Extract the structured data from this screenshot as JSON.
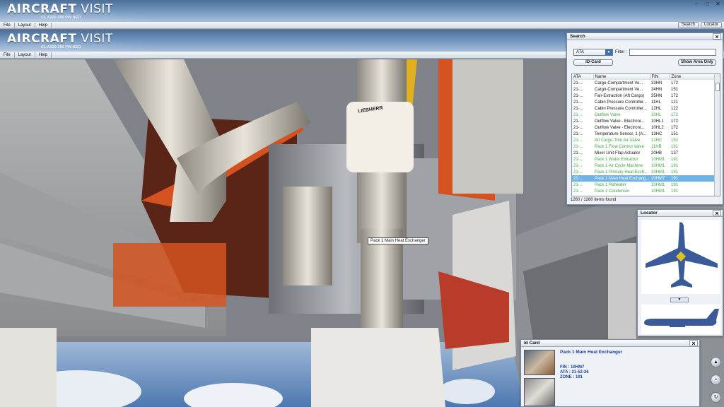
{
  "app": {
    "title_bold": "AIRCRAFT",
    "title_light": " VISIT",
    "subtitle": "CL A320-200 PW NEO",
    "menu": [
      "File",
      "Layout",
      "Help"
    ],
    "buttons": {
      "search": "Search",
      "locator": "Locator"
    }
  },
  "scene": {
    "tooltip": "Pack 1 Main Heat Exchanger",
    "sticker_brand": "LIEBHERR"
  },
  "search": {
    "title": "Search",
    "ata_select": "ATA",
    "filter_label": "Filter :",
    "filter_value": "",
    "id_card_button": "ID-Card",
    "show_area_button": "Show Area Only",
    "columns": [
      "ATA",
      "Name",
      "FIN",
      "Zone"
    ],
    "rows": [
      {
        "ata": "21-...",
        "name": "Cargo-Compartment Ve...",
        "fin": "33HN",
        "zone": "172",
        "style": "normal"
      },
      {
        "ata": "21-...",
        "name": "Cargo-Compartment Ve...",
        "fin": "34HN",
        "zone": "151",
        "style": "normal"
      },
      {
        "ata": "21-...",
        "name": "Fan-Extraction (Aft Cargo)",
        "fin": "35HN",
        "zone": "172",
        "style": "normal"
      },
      {
        "ata": "21-...",
        "name": "Cabin Pressure Controller...",
        "fin": "11HL",
        "zone": "121",
        "style": "normal"
      },
      {
        "ata": "21-...",
        "name": "Cabin Pressure Controller...",
        "fin": "12HL",
        "zone": "122",
        "style": "normal"
      },
      {
        "ata": "21-...",
        "name": "Outflow Valve",
        "fin": "10HL",
        "zone": "172",
        "style": "green"
      },
      {
        "ata": "21-...",
        "name": "Outflow Valve - Electroni...",
        "fin": "10HL1",
        "zone": "172",
        "style": "normal"
      },
      {
        "ata": "21-...",
        "name": "Outflow Valve - Electroni...",
        "fin": "10HL2",
        "zone": "172",
        "style": "normal"
      },
      {
        "ata": "21-...",
        "name": "Temperature Sensor, 1 (A...",
        "fin": "13HC",
        "zone": "151",
        "style": "normal"
      },
      {
        "ata": "21-...",
        "name": "Aft Cargo-Trim Air-Valve",
        "fin": "12HC",
        "zone": "151",
        "style": "green"
      },
      {
        "ata": "21-...",
        "name": "Pack 1 Flow Control Valve",
        "fin": "11HB",
        "zone": "191",
        "style": "green"
      },
      {
        "ata": "21-...",
        "name": "Mixer Unit-Flap Actuator",
        "fin": "20HB",
        "zone": "137",
        "style": "normal"
      },
      {
        "ata": "21-...",
        "name": "Pack 1 Water Extractor",
        "fin": "10HM1",
        "zone": "191",
        "style": "green"
      },
      {
        "ata": "21-...",
        "name": "Pack 1 Air Cycle Machine",
        "fin": "10HM1",
        "zone": "191",
        "style": "green"
      },
      {
        "ata": "21-...",
        "name": "Pack 1 Primary Heat Exch...",
        "fin": "10HM1",
        "zone": "191",
        "style": "green"
      },
      {
        "ata": "21-...",
        "name": "Pack 1 Main Heat Exchang...",
        "fin": "10HM7",
        "zone": "191",
        "style": "sel"
      },
      {
        "ata": "21-...",
        "name": "Pack 1 Reheater",
        "fin": "10HM1",
        "zone": "191",
        "style": "green"
      },
      {
        "ata": "21-...",
        "name": "Pack 1 Condenser",
        "fin": "10HM1",
        "zone": "191",
        "style": "green"
      }
    ],
    "status": "1260 / 1260 items found"
  },
  "locator": {
    "title": "Locator"
  },
  "idcard": {
    "title": "Id Card",
    "name": "Pack 1 Main Heat Exchanger",
    "fin": "FIN : 10HM7",
    "ata": "ATA : 21-52-26",
    "zone": "ZONE : 191"
  },
  "colors": {
    "accent": "#4d6f97",
    "selected": "#6fb3e6",
    "green_text": "#3aa53a",
    "duct_orange": "#d4521f"
  }
}
